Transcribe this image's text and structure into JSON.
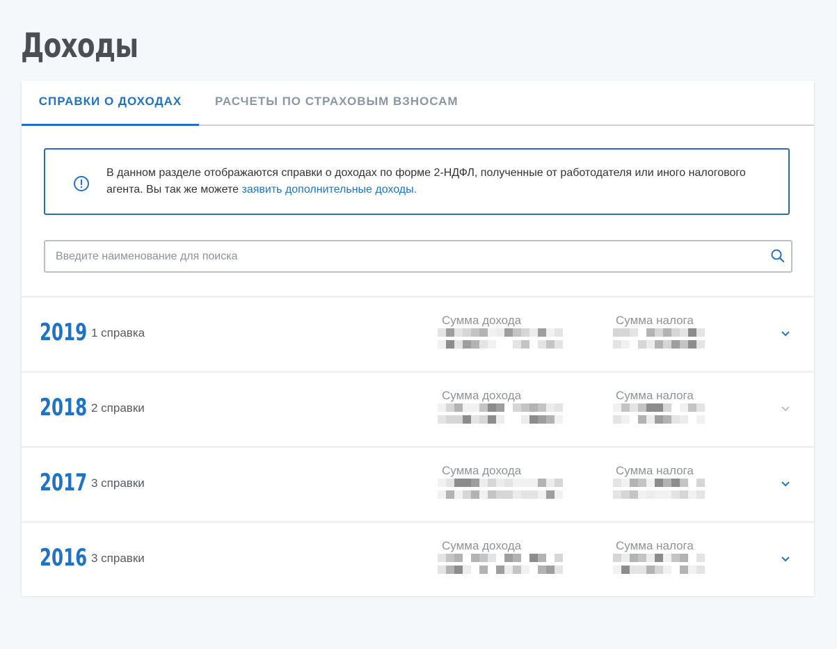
{
  "page": {
    "title": "Доходы"
  },
  "tabs": [
    {
      "label": "СПРАВКИ О ДОХОДАХ",
      "active": true
    },
    {
      "label": "РАСЧЕТЫ ПО СТРАХОВЫМ ВЗНОСАМ",
      "active": false
    }
  ],
  "info": {
    "text": "В данном разделе отображаются справки о доходах по форме 2-НДФЛ, полученные от работодателя или иного налогового агента. Вы так же можете ",
    "link_text": "заявить дополнительные доходы."
  },
  "search": {
    "placeholder": "Введите наименование для поиска",
    "value": ""
  },
  "years": [
    {
      "year": "2019",
      "count": "1 справка",
      "income_label": "Сумма дохода",
      "tax_label": "Сумма налога"
    },
    {
      "year": "2018",
      "count": "2 справки",
      "income_label": "Сумма дохода",
      "tax_label": "Сумма налога"
    },
    {
      "year": "2017",
      "count": "3 справки",
      "income_label": "Сумма дохода",
      "tax_label": "Сумма налога"
    },
    {
      "year": "2016",
      "count": "3 справки",
      "income_label": "Сумма дохода",
      "tax_label": "Сумма налога"
    }
  ],
  "colors": {
    "accent": "#1f73c6",
    "info_border": "#2a6fa8",
    "title": "#4b4e52",
    "muted": "#8d939a",
    "background": "#f4f8fb"
  },
  "icons": {
    "info": "info-icon",
    "search": "search-icon",
    "expand": "chevron-down-icon"
  }
}
